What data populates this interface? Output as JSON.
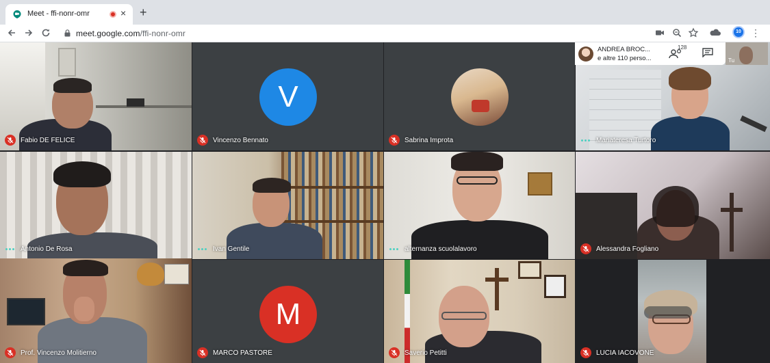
{
  "browser": {
    "tab_title": "Meet - ffi-nonr-omr",
    "tab_close": "×",
    "new_tab": "+",
    "url_host": "meet.google.com",
    "url_path": "/ffi-nonr-omr",
    "profile_badge": "10",
    "icons": [
      "back-icon",
      "forward-icon",
      "reload-icon",
      "lock-icon",
      "camera-icon",
      "zoom-icon",
      "star-icon",
      "extension-icon",
      "kebab-menu-icon"
    ]
  },
  "meet": {
    "presenter_name": "ANDREA BROC...",
    "others": "e altre 110 perso...",
    "participants_count": "128",
    "self_label": "Tu",
    "accent": "#4dd0c1",
    "mute_color": "#d93025"
  },
  "participants": [
    {
      "name": "Fabio DE FELICE",
      "mic": "muted"
    },
    {
      "name": "Vincenzo Bennato",
      "mic": "muted",
      "initial": "V",
      "avatar_color": "#1e88e5"
    },
    {
      "name": "Sabrina Improta",
      "mic": "muted"
    },
    {
      "name": "Mariateresa Turtoro",
      "mic": "speaking"
    },
    {
      "name": "Antonio De Rosa",
      "mic": "speaking"
    },
    {
      "name": "Ivan Gentile",
      "mic": "speaking"
    },
    {
      "name": "alternanza scuolalavoro",
      "mic": "speaking"
    },
    {
      "name": "Alessandra Fogliano",
      "mic": "muted"
    },
    {
      "name": "Prof. Vincenzo Molitierno",
      "mic": "muted"
    },
    {
      "name": "MARCO PASTORE",
      "mic": "muted",
      "initial": "M",
      "avatar_color": "#d93025"
    },
    {
      "name": "Saverio Petitti",
      "mic": "muted"
    },
    {
      "name": "LUCIA IACOVONE",
      "mic": "muted"
    }
  ]
}
